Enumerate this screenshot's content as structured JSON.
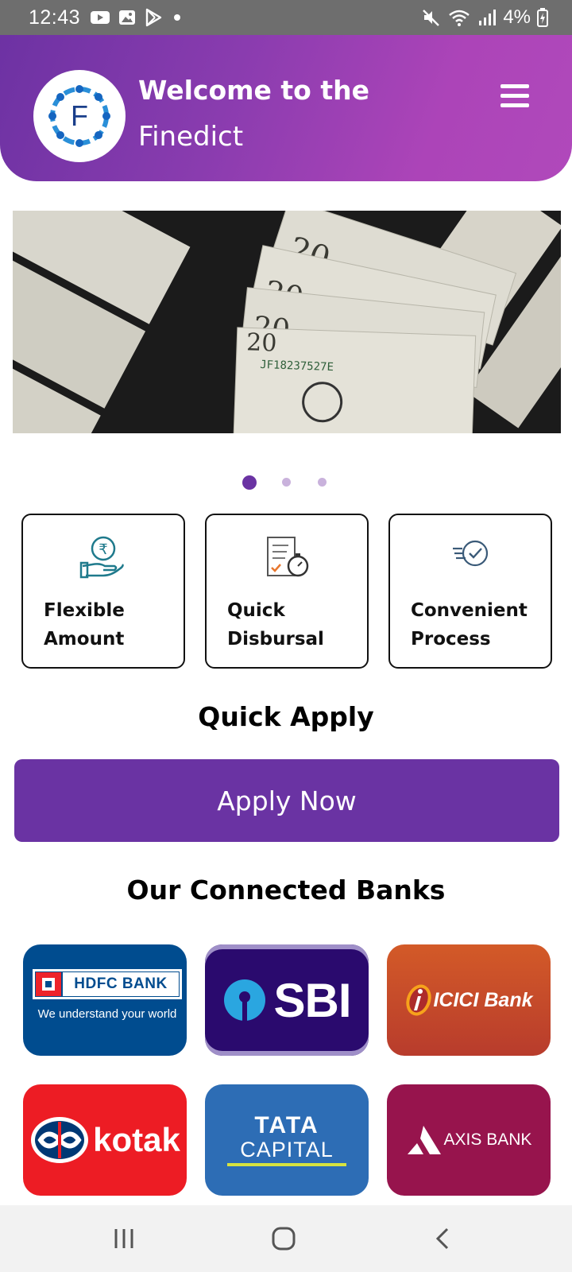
{
  "status_bar": {
    "time": "12:43",
    "battery": "4%",
    "left_icons": [
      "youtube-icon",
      "gallery-icon",
      "play-store-icon",
      "dot-icon"
    ],
    "right_icons": [
      "mute-icon",
      "wifi-icon",
      "signal-icon",
      "battery-charging-icon"
    ]
  },
  "header": {
    "welcome": "Welcome to the",
    "app_name": "Finedict",
    "logo_letter": "F",
    "gradient": [
      "#6d32a3",
      "#b049bb"
    ]
  },
  "carousel": {
    "image": "money-banner",
    "pages": 3,
    "active_page": 1
  },
  "features": [
    {
      "label": "Flexible\nAmount",
      "icon": "rupee-hand-icon"
    },
    {
      "label": "Quick\nDisbursal",
      "icon": "document-stopwatch-icon"
    },
    {
      "label": "Convenient\nProcess",
      "icon": "check-process-icon"
    }
  ],
  "quick_apply": {
    "title": "Quick Apply",
    "button": "Apply Now",
    "button_color": "#6a33a3"
  },
  "banks": {
    "title": "Our Connected Banks",
    "items": [
      {
        "name": "HDFC BANK",
        "tagline": "We understand your world",
        "color": "#004c8f"
      },
      {
        "name": "SBI",
        "color": "#2a0a6e"
      },
      {
        "name": "ICICI Bank",
        "color": "#c84e2a"
      },
      {
        "name": "kotak",
        "color": "#ed1c24"
      },
      {
        "name": "TATA",
        "name2": "CAPITAL",
        "color": "#2d6db5"
      },
      {
        "name": "AXIS BANK",
        "color": "#97144d"
      }
    ]
  },
  "nav": {
    "icons": [
      "recents-icon",
      "home-icon",
      "back-icon"
    ]
  }
}
